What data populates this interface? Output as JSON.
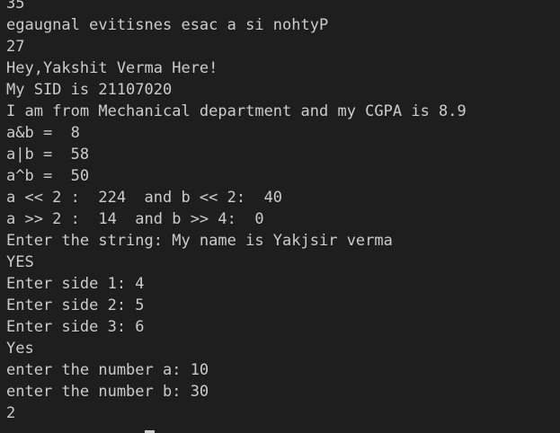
{
  "terminal": {
    "lines": [
      "35",
      "egaugnal evitisnes esac a si nohtyP",
      "27",
      "Hey,Yakshit Verma Here!",
      "My SID is 21107020",
      "I am from Mechanical department and my CGPA is 8.9",
      "a&b =  8",
      "a|b =  58",
      "a^b =  50",
      "a << 2 :  224  and b << 2:  40",
      "a >> 2 :  14  and b >> 4:  0",
      "Enter the string: My name is Yakjsir verma",
      "YES",
      "Enter side 1: 4",
      "Enter side 2: 5",
      "Enter side 3: 6",
      "Yes",
      "enter the number a: 10",
      "enter the number b: 30",
      "2"
    ]
  },
  "colors": {
    "background": "#1e1e1e",
    "foreground": "#cccccc"
  }
}
